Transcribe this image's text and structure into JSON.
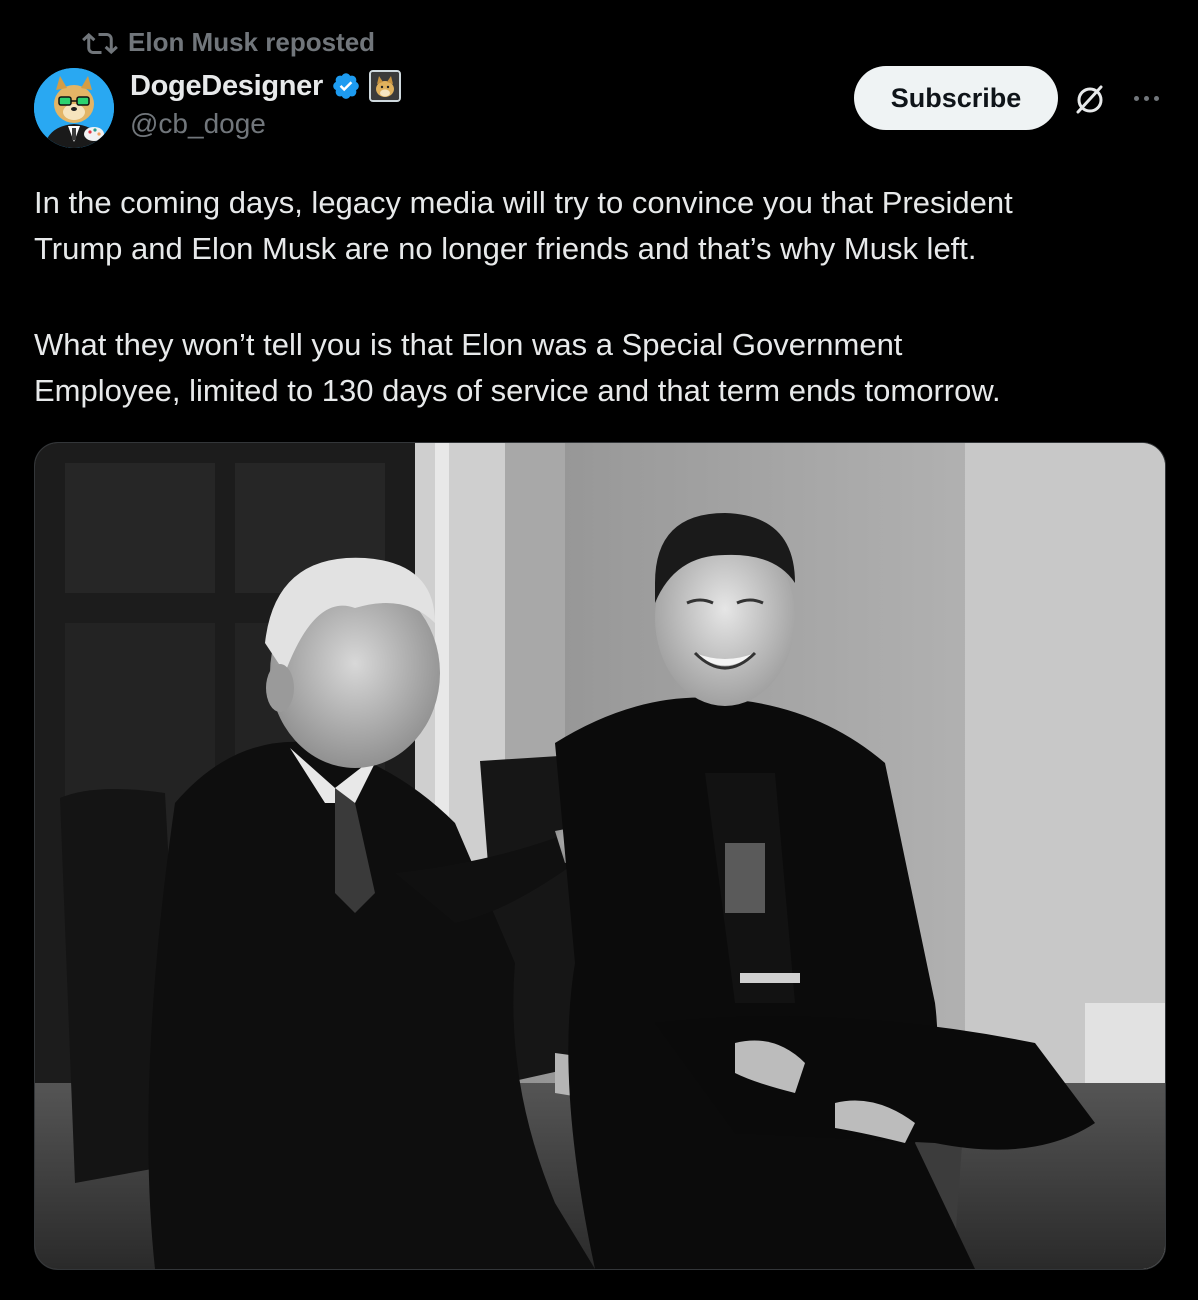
{
  "repost": {
    "icon": "repost-icon",
    "label": "Elon Musk reposted"
  },
  "author": {
    "avatar": "doge-avatar",
    "display_name": "DogeDesigner",
    "verified_icon": "verified-badge-icon",
    "affiliate_icon": "doge-affiliate-badge",
    "handle": "@cb_doge"
  },
  "actions": {
    "subscribe_label": "Subscribe",
    "grok_icon": "grok-icon",
    "more_icon": "more-options-icon"
  },
  "tweet": {
    "paragraphs": [
      [
        "In the coming days, legacy media will try to convince you that President",
        "Trump and Elon Musk are no longer friends and that’s why Musk left."
      ],
      [
        "What they won’t tell you is that Elon was a Special Government",
        "Employee, limited to 130 days of service and that term ends tomorrow."
      ]
    ]
  },
  "media": {
    "kind": "photo",
    "style": "black-and-white"
  },
  "colors": {
    "background": "#000000",
    "text_primary": "#e7e9ea",
    "text_secondary": "#71767b",
    "verified": "#1d9bf0",
    "button_bg": "#eff3f4",
    "button_text": "#0f1419"
  }
}
